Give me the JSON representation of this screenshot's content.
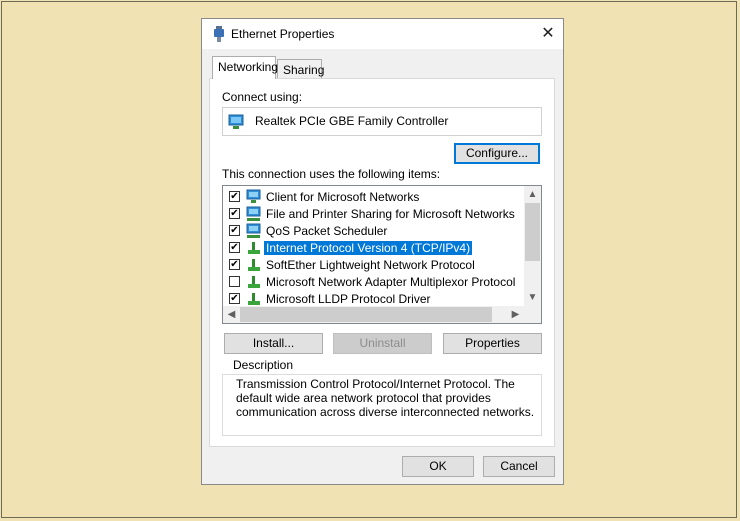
{
  "window": {
    "title": "Ethernet Properties",
    "close_glyph": "✕"
  },
  "tabs": [
    {
      "label": "Networking"
    },
    {
      "label": "Sharing"
    }
  ],
  "connect_using": {
    "label": "Connect using:",
    "adapter": "Realtek PCIe GBE Family Controller",
    "adapter_icon": "network-adapter-icon"
  },
  "configure_button": "Configure...",
  "items_label": "This connection uses the following items:",
  "items": [
    {
      "label": "Client for Microsoft Networks",
      "checked": true,
      "icon": "network-client-icon"
    },
    {
      "label": "File and Printer Sharing for Microsoft Networks",
      "checked": true,
      "icon": "network-service-icon"
    },
    {
      "label": "QoS Packet Scheduler",
      "checked": true,
      "icon": "network-service-icon"
    },
    {
      "label": "Internet Protocol Version 4 (TCP/IPv4)",
      "checked": true,
      "selected": true,
      "icon": "protocol-icon"
    },
    {
      "label": "SoftEther Lightweight Network Protocol",
      "checked": true,
      "icon": "protocol-icon"
    },
    {
      "label": "Microsoft Network Adapter Multiplexor Protocol",
      "checked": false,
      "icon": "protocol-icon"
    },
    {
      "label": "Microsoft LLDP Protocol Driver",
      "checked": true,
      "icon": "protocol-icon"
    }
  ],
  "buttons": {
    "install": "Install...",
    "uninstall": "Uninstall",
    "properties": "Properties",
    "ok": "OK",
    "cancel": "Cancel"
  },
  "description": {
    "title": "Description",
    "text": "Transmission Control Protocol/Internet Protocol. The default wide area network protocol that provides communication across diverse interconnected networks."
  },
  "scroll_glyphs": {
    "up": "▲",
    "down": "▼",
    "left": "◀",
    "right": "▶"
  },
  "colors": {
    "selection": "#0078d7",
    "background": "#f1e2b4"
  }
}
